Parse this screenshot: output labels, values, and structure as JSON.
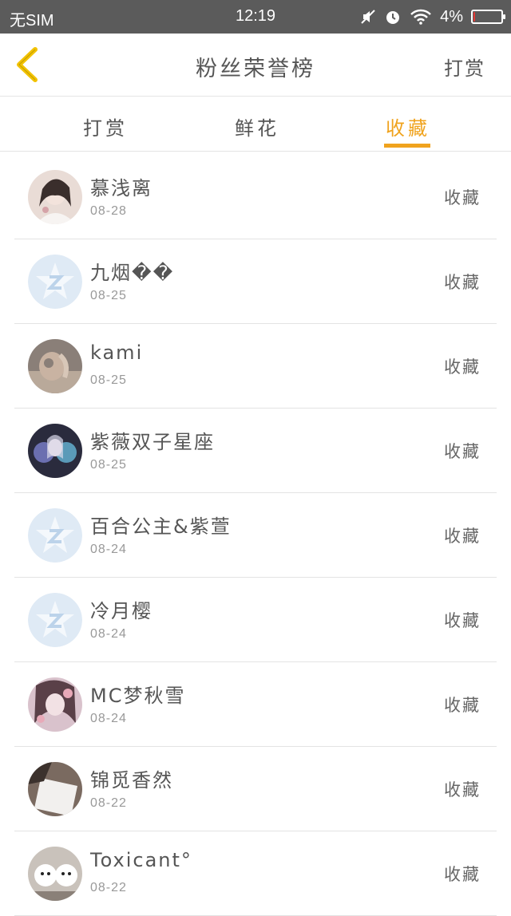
{
  "status_bar": {
    "carrier": "无SIM",
    "time": "12:19",
    "battery": "4%",
    "battery_level": 0.04
  },
  "header": {
    "title": "粉丝荣誉榜",
    "right_action": "打赏",
    "accent_color": "#f0a31e"
  },
  "tabs": [
    {
      "label": "打赏",
      "active": false
    },
    {
      "label": "鲜花",
      "active": false
    },
    {
      "label": "收藏",
      "active": true
    }
  ],
  "list": [
    {
      "name": "慕浅离",
      "date": "08-28",
      "action": "收藏",
      "avatar": "photo-girl"
    },
    {
      "name": "九烟��",
      "date": "08-25",
      "action": "收藏",
      "avatar": "default-star"
    },
    {
      "name": "kami",
      "date": "08-25",
      "action": "收藏",
      "avatar": "photo-hand"
    },
    {
      "name": "紫薇双子星座",
      "date": "08-25",
      "action": "收藏",
      "avatar": "photo-anime"
    },
    {
      "name": "百合公主&紫萱",
      "date": "08-24",
      "action": "收藏",
      "avatar": "default-star"
    },
    {
      "name": "冷月樱",
      "date": "08-24",
      "action": "收藏",
      "avatar": "default-star"
    },
    {
      "name": "MC梦秋雪",
      "date": "08-24",
      "action": "收藏",
      "avatar": "photo-anime-pink"
    },
    {
      "name": "锦觅香然",
      "date": "08-22",
      "action": "收藏",
      "avatar": "photo-paper"
    },
    {
      "name": "Toxicant°",
      "date": "08-22",
      "action": "收藏",
      "avatar": "photo-dogs"
    }
  ]
}
